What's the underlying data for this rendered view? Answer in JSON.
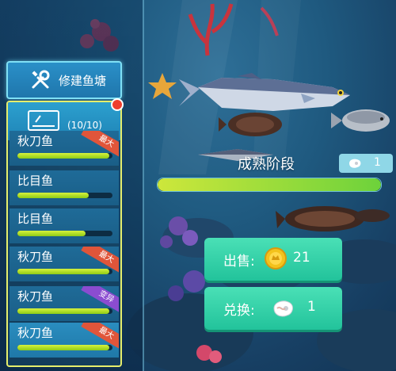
{
  "left_panel": {
    "build_button_label": "修建鱼塘",
    "tank_count": "(10/10)",
    "fish": [
      {
        "name": "秋刀鱼",
        "badge": "最大",
        "badge_color": "#e0553a",
        "progress": 0.97
      },
      {
        "name": "比目鱼",
        "badge": "",
        "badge_color": "",
        "progress": 0.75
      },
      {
        "name": "比目鱼",
        "badge": "",
        "badge_color": "",
        "progress": 0.72
      },
      {
        "name": "秋刀鱼",
        "badge": "最大",
        "badge_color": "#e0553a",
        "progress": 0.97
      },
      {
        "name": "秋刀鱼",
        "badge": "变异",
        "badge_color": "#8b4cd0",
        "progress": 0.97
      },
      {
        "name": "秋刀鱼",
        "badge": "最大",
        "badge_color": "#e0553a",
        "progress": 0.97
      }
    ],
    "selected_index": 5
  },
  "hud": {
    "stage_label": "成熟阶段",
    "stage_progress": 1.0,
    "stage_badge_value": "1"
  },
  "actions": {
    "sell_label": "出售:",
    "sell_value": "21",
    "exchange_label": "兑换:",
    "exchange_value": "1"
  },
  "colors": {
    "accent_teal": "#2cc9a1",
    "panel_yellow": "#e6ee6b",
    "progress_green": "#8ecb16"
  }
}
